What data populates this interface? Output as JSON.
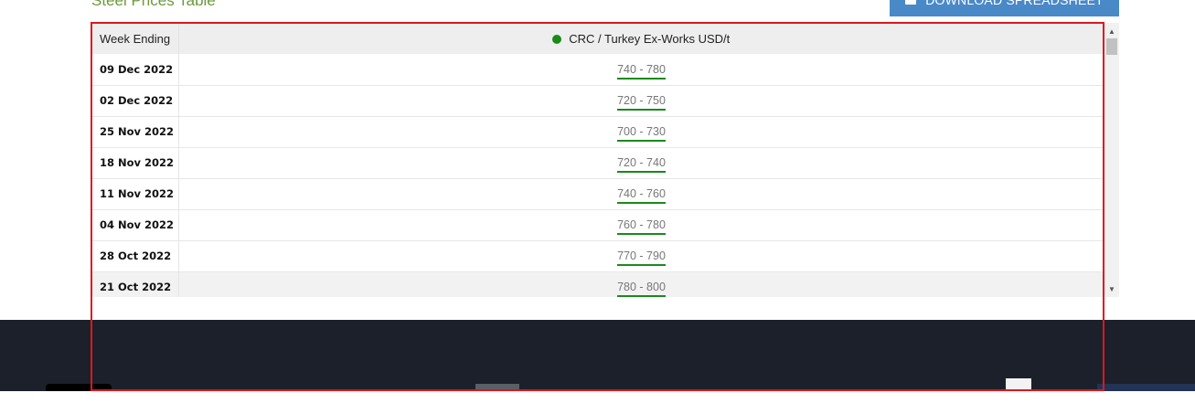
{
  "section": {
    "title": "Steel Prices Table",
    "download_label": "DOWNLOAD SPREADSHEET"
  },
  "table": {
    "columns": [
      "Week Ending",
      "CRC / Turkey Ex-Works USD/t"
    ],
    "series_color": "#1a8a1a",
    "rows": [
      {
        "week": "09 Dec 2022",
        "price": "740 - 780"
      },
      {
        "week": "02 Dec 2022",
        "price": "720 - 750"
      },
      {
        "week": "25 Nov 2022",
        "price": "700 - 730"
      },
      {
        "week": "18 Nov 2022",
        "price": "720 - 740"
      },
      {
        "week": "11 Nov 2022",
        "price": "740 - 760"
      },
      {
        "week": "04 Nov 2022",
        "price": "760 - 780"
      },
      {
        "week": "28 Oct 2022",
        "price": "770 - 790"
      },
      {
        "week": "21 Oct 2022",
        "price": "780 - 800"
      }
    ]
  },
  "colors": {
    "accent_green": "#6a9a3a",
    "button_blue": "#4a89c8",
    "footer_bg": "#1c202a",
    "highlight_red": "#e0161c"
  }
}
